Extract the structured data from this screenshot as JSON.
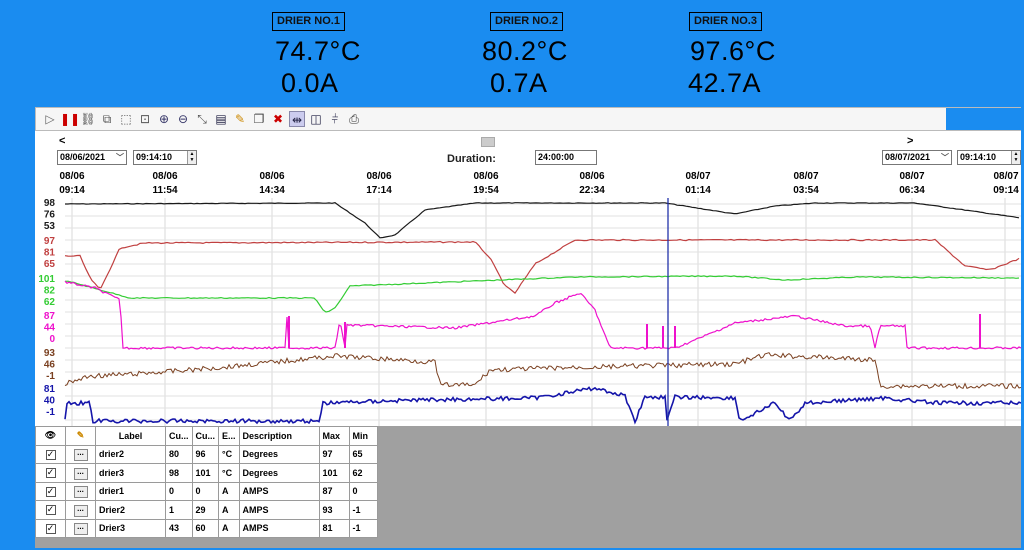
{
  "driers": [
    {
      "title": "DRIER NO.1",
      "temp": "74.7°C",
      "amps": "0.0A"
    },
    {
      "title": "DRIER NO.2",
      "temp": "80.2°C",
      "amps": "0.7A"
    },
    {
      "title": "DRIER NO.3",
      "temp": "97.6°C",
      "amps": "42.7A"
    }
  ],
  "toolbar": {
    "icons": [
      "play-icon",
      "pause-icon",
      "link-icon",
      "zoom-page-icon",
      "zoom-region-icon",
      "zoom-box-icon",
      "zoom-in-icon",
      "zoom-out-icon",
      "zoom-reset-icon",
      "table-icon",
      "pen-icon",
      "copy-icon",
      "delete-icon",
      "cursor-icon",
      "split-icon",
      "marker-icon",
      "print-icon"
    ]
  },
  "scroll": {
    "left": "<",
    "right": ">"
  },
  "controls": {
    "start_date": "08/06/2021",
    "start_time": "09:14:10",
    "duration_label": "Duration:",
    "duration_value": "24:00:00",
    "end_date": "08/07/2021",
    "end_time": "09:14:10"
  },
  "time_axis": [
    {
      "date": "08/06",
      "time": "09:14"
    },
    {
      "date": "08/06",
      "time": "11:54"
    },
    {
      "date": "08/06",
      "time": "14:34"
    },
    {
      "date": "08/06",
      "time": "17:14"
    },
    {
      "date": "08/06",
      "time": "19:54"
    },
    {
      "date": "08/06",
      "time": "22:34"
    },
    {
      "date": "08/07",
      "time": "01:14"
    },
    {
      "date": "08/07",
      "time": "03:54"
    },
    {
      "date": "08/07",
      "time": "06:34"
    },
    {
      "date": "08/07",
      "time": "09:14"
    }
  ],
  "chart_bands": [
    {
      "color": "#1a1a1a",
      "ticks": [
        "98",
        "76",
        "53"
      ]
    },
    {
      "color": "#c04040",
      "ticks": [
        "97",
        "81",
        "65"
      ]
    },
    {
      "color": "#33cc33",
      "ticks": [
        "101",
        "82",
        "62"
      ]
    },
    {
      "color": "#ee11cc",
      "ticks": [
        "87",
        "44",
        "0"
      ]
    },
    {
      "color": "#7a4020",
      "ticks": [
        "93",
        "46",
        "-1"
      ]
    },
    {
      "color": "#1515aa",
      "ticks": [
        "81",
        "40",
        "-1"
      ]
    }
  ],
  "legend": {
    "headers": [
      "",
      "",
      "Label",
      "Cu...",
      "Cu...",
      "E...",
      "Description",
      "Max",
      "Min"
    ],
    "rows": [
      {
        "label": "drier2",
        "c1": "80",
        "c2": "96",
        "unit": "°C",
        "desc": "Degrees",
        "max": "97",
        "min": "65"
      },
      {
        "label": "drier3",
        "c1": "98",
        "c2": "101",
        "unit": "°C",
        "desc": "Degrees",
        "max": "101",
        "min": "62"
      },
      {
        "label": "drier1",
        "c1": "0",
        "c2": "0",
        "unit": "A",
        "desc": "AMPS",
        "max": "87",
        "min": "0"
      },
      {
        "label": "Drier2",
        "c1": "1",
        "c2": "29",
        "unit": "A",
        "desc": "AMPS",
        "max": "93",
        "min": "-1"
      },
      {
        "label": "Drier3",
        "c1": "43",
        "c2": "60",
        "unit": "A",
        "desc": "AMPS",
        "max": "81",
        "min": "-1"
      }
    ]
  }
}
